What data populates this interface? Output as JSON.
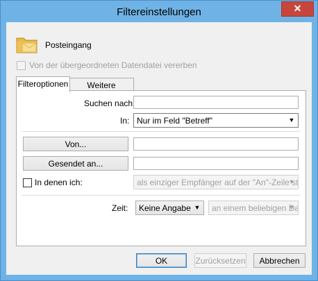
{
  "window": {
    "title": "Filtereinstellungen",
    "close_glyph": "✕"
  },
  "folder": {
    "icon": "folder-mail-icon",
    "name": "Posteingang"
  },
  "inherit": {
    "label": "Von der übergeordneten Datendatei vererben",
    "checked": false,
    "enabled": false
  },
  "tabs": [
    {
      "label": "Filteroptionen",
      "active": true
    },
    {
      "label": "Weitere Optionen",
      "active": false
    }
  ],
  "filter": {
    "search_label": "Suchen nach:",
    "search_value": "",
    "in_label": "In:",
    "in_value": "Nur im Feld \"Betreff\"",
    "from_button": "Von...",
    "from_value": "",
    "sent_to_button": "Gesendet an...",
    "sent_to_value": "",
    "where_i_label": "In denen ich:",
    "where_i_checked": false,
    "where_i_value": "als einziger Empfänger auf der \"An\"-Zeile stehe",
    "time_label": "Zeit:",
    "time_value": "Keine Angabe",
    "time_range_value": "an einem beliebigen Datum"
  },
  "buttons": {
    "ok": "OK",
    "reset": "Zurücksetzen",
    "cancel": "Abbrechen"
  },
  "colors": {
    "titlebar": "#6fb3e6",
    "close": "#c7463c",
    "dialog_bg": "#f0f0f0"
  }
}
